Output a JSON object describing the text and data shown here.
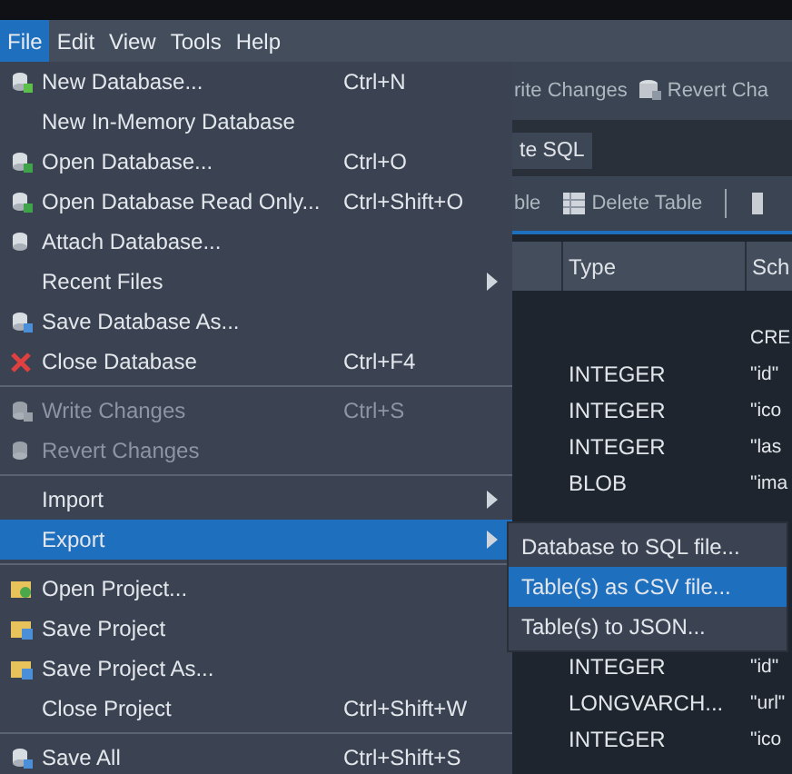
{
  "menubar": [
    {
      "label": "File",
      "selected": true
    },
    {
      "label": "Edit",
      "selected": false
    },
    {
      "label": "View",
      "selected": false
    },
    {
      "label": "Tools",
      "selected": false
    },
    {
      "label": "Help",
      "selected": false
    }
  ],
  "toolbar": [
    {
      "kind": "cut",
      "label": "rite Changes"
    },
    {
      "kind": "icon",
      "label": "Revert Cha"
    }
  ],
  "tab": {
    "label": "te SQL"
  },
  "toolbar2": [
    {
      "kind": "cut",
      "label": "ble"
    },
    {
      "kind": "icon",
      "label": "Delete Table"
    }
  ],
  "table": {
    "columns": [
      "Type",
      "Sch"
    ],
    "rows": [
      {
        "type": "",
        "schema": "CRE"
      },
      {
        "type": "INTEGER",
        "schema": "\"id\""
      },
      {
        "type": "INTEGER",
        "schema": "\"ico"
      },
      {
        "type": "INTEGER",
        "schema": "\"las"
      },
      {
        "type": "BLOB",
        "schema": "\"ima"
      }
    ],
    "rows_below": [
      {
        "type": "INTEGER",
        "schema": "\"id\""
      },
      {
        "type": "LONGVARCH...",
        "schema": "\"url\""
      },
      {
        "type": "INTEGER",
        "schema": "\"ico"
      }
    ]
  },
  "file_menu": [
    {
      "kind": "new-db",
      "label": "New Database...",
      "shortcut": "Ctrl+N",
      "disabled": false,
      "selected": false,
      "submenu": false
    },
    {
      "kind": "plain",
      "label": "New In-Memory Database",
      "disabled": false,
      "selected": false,
      "submenu": false
    },
    {
      "kind": "open-db",
      "label": "Open Database...",
      "shortcut": "Ctrl+O",
      "disabled": false,
      "selected": false,
      "submenu": false
    },
    {
      "kind": "open-db",
      "label": "Open Database Read Only...",
      "shortcut": "Ctrl+Shift+O",
      "disabled": false,
      "selected": false,
      "submenu": false
    },
    {
      "kind": "attach-db",
      "label": "Attach Database...",
      "disabled": false,
      "selected": false,
      "submenu": false
    },
    {
      "kind": "plain",
      "label": "Recent Files",
      "disabled": false,
      "selected": false,
      "submenu": true
    },
    {
      "kind": "save-db",
      "label": "Save Database As...",
      "disabled": false,
      "selected": false,
      "submenu": false
    },
    {
      "kind": "close-db",
      "label": "Close Database",
      "shortcut": "Ctrl+F4",
      "disabled": false,
      "selected": false,
      "submenu": false
    },
    {
      "kind": "separator"
    },
    {
      "kind": "save-db",
      "label": "Write Changes",
      "shortcut": "Ctrl+S",
      "disabled": true,
      "selected": false,
      "submenu": false
    },
    {
      "kind": "attach-db",
      "label": "Revert Changes",
      "disabled": true,
      "selected": false,
      "submenu": false
    },
    {
      "kind": "separator"
    },
    {
      "kind": "plain",
      "label": "Import",
      "disabled": false,
      "selected": false,
      "submenu": true
    },
    {
      "kind": "plain",
      "label": "Export",
      "disabled": false,
      "selected": true,
      "submenu": true
    },
    {
      "kind": "separator"
    },
    {
      "kind": "open-project",
      "label": "Open Project...",
      "disabled": false,
      "selected": false,
      "submenu": false
    },
    {
      "kind": "save-project",
      "label": "Save Project",
      "disabled": false,
      "selected": false,
      "submenu": false
    },
    {
      "kind": "save-project",
      "label": "Save Project As...",
      "disabled": false,
      "selected": false,
      "submenu": false
    },
    {
      "kind": "plain",
      "label": "Close Project",
      "shortcut": "Ctrl+Shift+W",
      "disabled": false,
      "selected": false,
      "submenu": false
    },
    {
      "kind": "separator"
    },
    {
      "kind": "save-db",
      "label": "Save All",
      "shortcut": "Ctrl+Shift+S",
      "disabled": false,
      "selected": false,
      "submenu": false
    }
  ],
  "export_submenu": [
    {
      "label": "Database to SQL file...",
      "selected": false
    },
    {
      "label": "Table(s) as CSV file...",
      "selected": true
    },
    {
      "label": "Table(s) to JSON...",
      "selected": false
    }
  ]
}
